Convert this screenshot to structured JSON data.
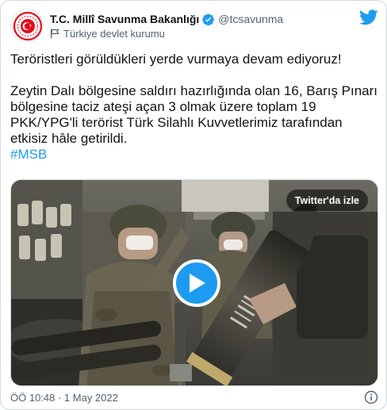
{
  "tweet": {
    "author": {
      "display_name": "T.C. Millî Savunma Bakanlığı",
      "handle": "@tcsavunma",
      "verified": true,
      "label": "Türkiye devlet kurumu",
      "avatar_icon": "ministry-emblem"
    },
    "text": {
      "line1": "Teröristleri görüldükleri yerde vurmaya devam ediyoruz!",
      "paragraph2": "Zeytin Dalı bölgesine saldırı hazırlığında olan 16, Barış Pınarı bölgesine taciz ateşi açan 3 olmak üzere toplam 19 PKK/YPG'li terörist Türk Silahlı Kuvvetlerimiz tarafından etkisiz hâle getirildi.",
      "hashtag": "#MSB"
    },
    "media": {
      "watch_label": "Twitter'da izle",
      "play_icon": "play-icon"
    },
    "timestamp": "ÖÖ 10:48 · 1 May 2022"
  },
  "colors": {
    "brand": "#1d9bf0",
    "text": "#0f1419",
    "secondary": "#536471",
    "border": "#cfd9de"
  },
  "icons": [
    "twitter-bird-icon",
    "verified-badge-icon",
    "government-flag-icon",
    "info-icon",
    "play-icon"
  ]
}
